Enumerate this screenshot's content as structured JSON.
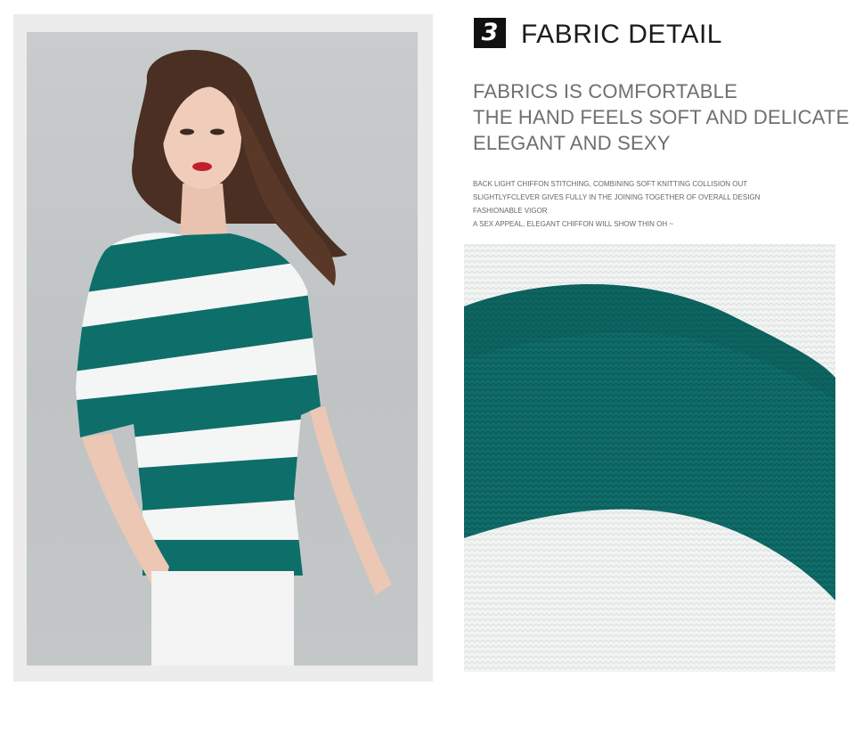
{
  "step": {
    "number": "3",
    "title": "FABRIC DETAIL"
  },
  "headlines": [
    "FABRICS IS COMFORTABLE",
    "THE HAND FEELS SOFT AND DELICATE",
    "ELEGANT AND SEXY"
  ],
  "description": [
    "BACK LIGHT CHIFFON STITCHING, COMBINING SOFT KNITTING COLLISION OUT",
    "SLIGHTLYFCLEVER GIVES FULLY IN THE JOINING TOGETHER OF OVERALL DESIGN",
    "FASHIONABLE VIGOR",
    "A SEX APPEAL, ELEGANT CHIFFON WILL SHOW THIN OH ~"
  ],
  "colors": {
    "stripe_teal": "#0e6e6a",
    "stripe_white": "#f4f6f5",
    "badge_bg": "#111111"
  }
}
